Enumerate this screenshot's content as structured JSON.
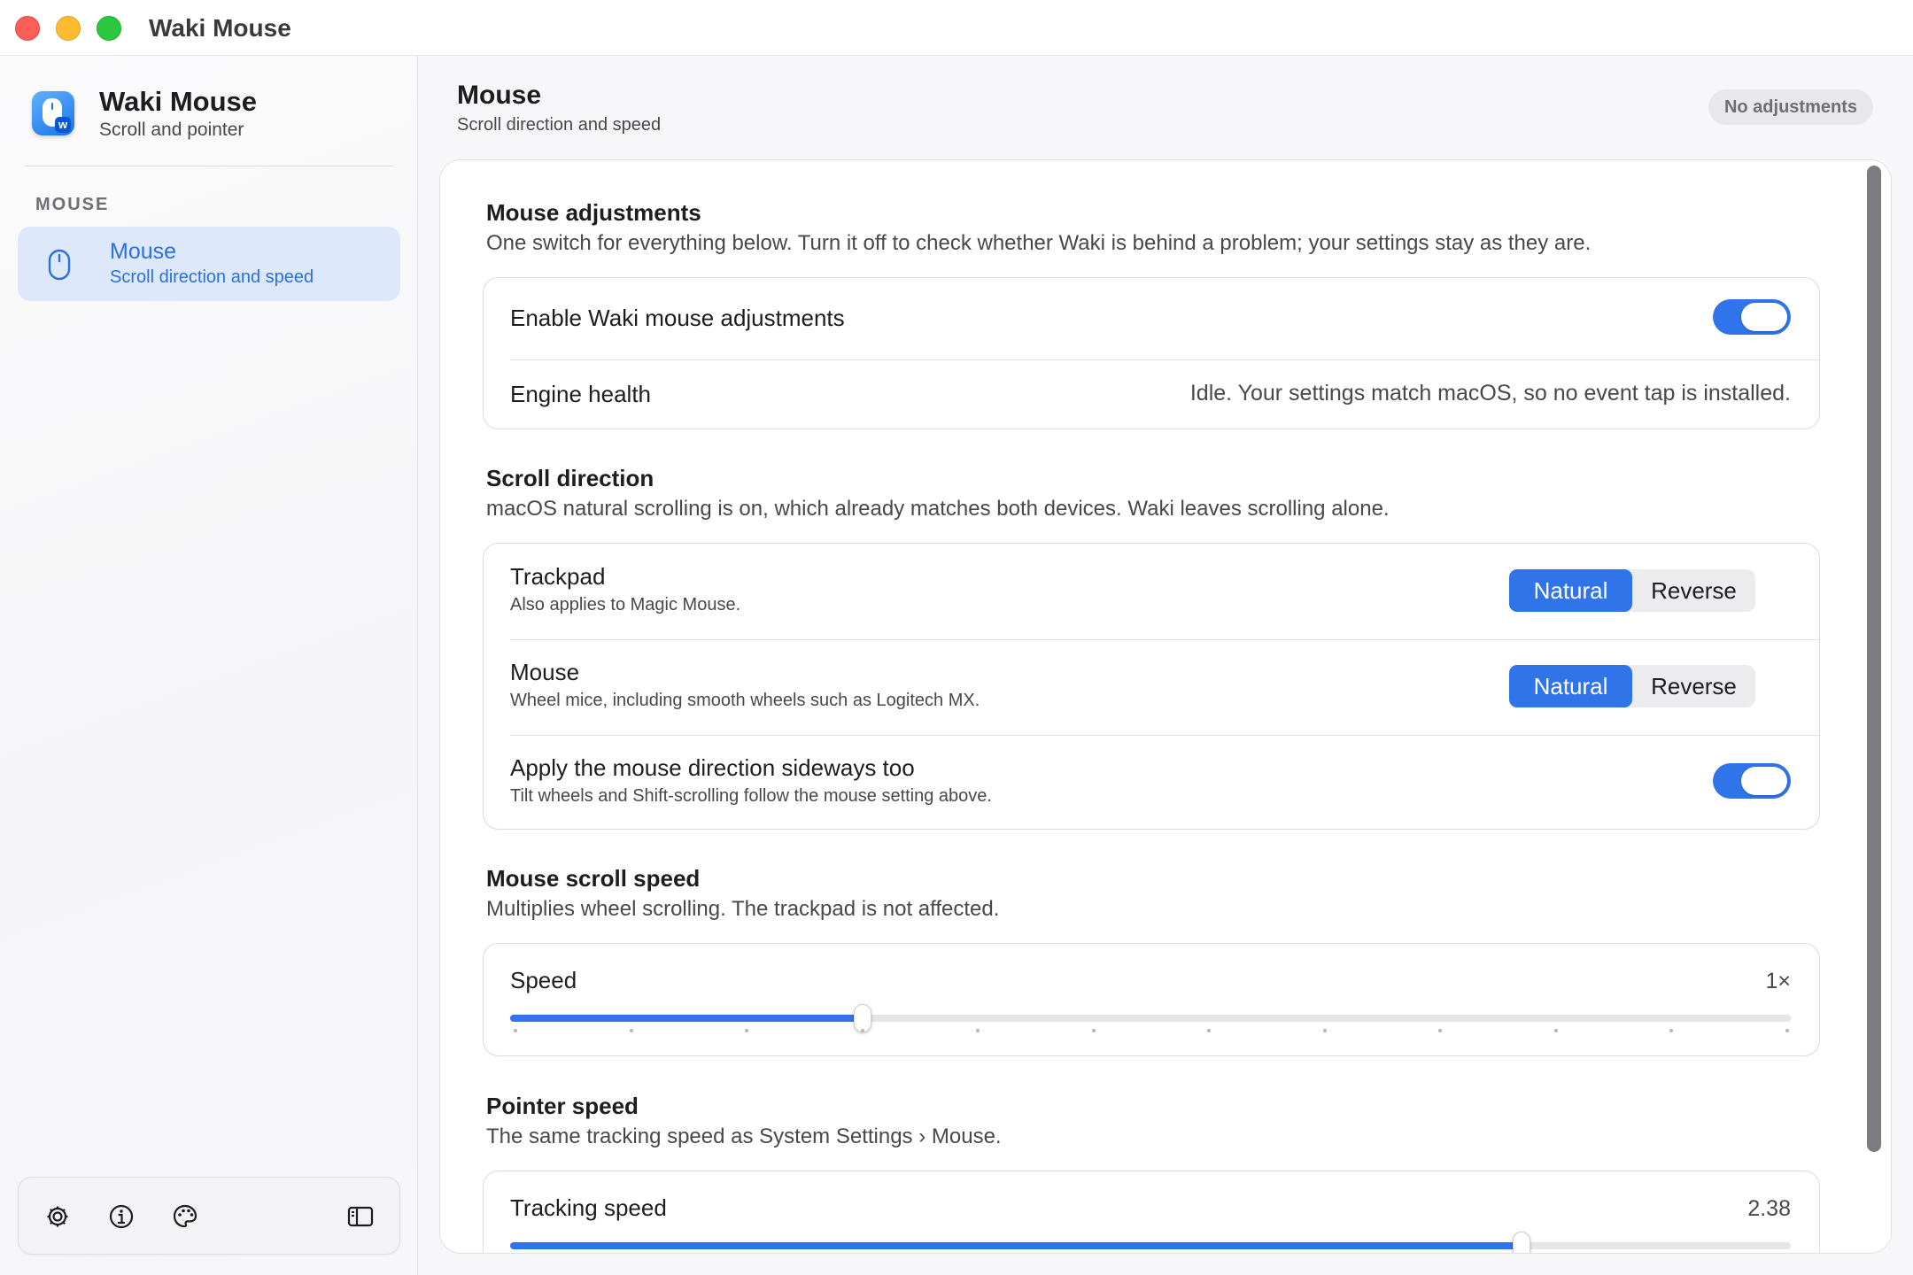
{
  "window": {
    "title": "Waki Mouse"
  },
  "sidebar": {
    "app_name": "Waki Mouse",
    "app_subtitle": "Scroll and pointer",
    "section_label": "MOUSE",
    "items": [
      {
        "title": "Mouse",
        "subtitle": "Scroll direction and speed",
        "icon": "mouse-icon",
        "selected": true
      }
    ],
    "toolbar": [
      "gear-icon",
      "info-icon",
      "palette-icon",
      "sidebar-toggle-icon"
    ]
  },
  "header": {
    "title": "Mouse",
    "subtitle": "Scroll direction and speed",
    "badge": "No adjustments"
  },
  "adjustments": {
    "title": "Mouse adjustments",
    "description": "One switch for everything below. Turn it off to check whether Waki is behind a problem; your settings stay as they are.",
    "enable_label": "Enable Waki mouse adjustments",
    "enable_on": true,
    "health_label": "Engine health",
    "health_value": "Idle. Your settings match macOS, so no event tap is installed."
  },
  "scroll_direction": {
    "title": "Scroll direction",
    "description": "macOS natural scrolling is on, which already matches both devices. Waki leaves scrolling alone.",
    "trackpad": {
      "label": "Trackpad",
      "note": "Also applies to Magic Mouse.",
      "selected": "Natural"
    },
    "mouse": {
      "label": "Mouse",
      "note": "Wheel mice, including smooth wheels such as Logitech MX.",
      "selected": "Natural"
    },
    "options": {
      "natural": "Natural",
      "reverse": "Reverse"
    },
    "sideways": {
      "label": "Apply the mouse direction sideways too",
      "note": "Tilt wheels and Shift-scrolling follow the mouse setting above.",
      "on": true
    }
  },
  "scroll_speed": {
    "title": "Mouse scroll speed",
    "description": "Multiplies wheel scrolling. The trackpad is not affected.",
    "label": "Speed",
    "value_text": "1×",
    "fraction": 0.275
  },
  "pointer_speed": {
    "title": "Pointer speed",
    "description": "The same tracking speed as System Settings › Mouse.",
    "label": "Tracking speed",
    "value_text": "2.38",
    "fraction": 0.79
  },
  "colors": {
    "accent": "#2f74e8",
    "selected_bg": "#dde8fb"
  }
}
